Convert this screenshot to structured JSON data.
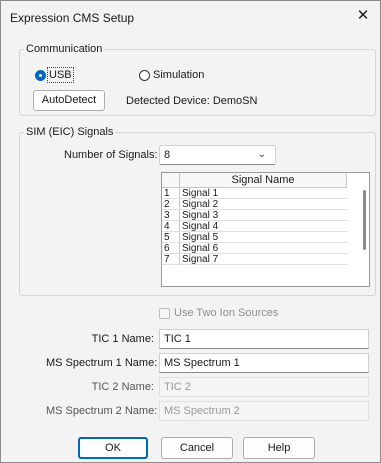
{
  "window": {
    "title": "Expression CMS Setup",
    "close_glyph": "✕"
  },
  "communication": {
    "group_label": "Communication",
    "usb_label": "USB",
    "simulation_label": "Simulation",
    "selected": "USB",
    "autodetect_label": "AutoDetect",
    "detected_text": "Detected Device: DemoSN"
  },
  "signals": {
    "group_label": "SIM (EIC) Signals",
    "count_label": "Number of Signals:",
    "count_value": "8",
    "table_header": "Signal Name",
    "rows": [
      {
        "num": "1",
        "name": "Signal 1"
      },
      {
        "num": "2",
        "name": "Signal 2"
      },
      {
        "num": "3",
        "name": "Signal 3"
      },
      {
        "num": "4",
        "name": "Signal 4"
      },
      {
        "num": "5",
        "name": "Signal 5"
      },
      {
        "num": "6",
        "name": "Signal 6"
      },
      {
        "num": "7",
        "name": "Signal 7"
      }
    ]
  },
  "ion_sources": {
    "label": "Use Two Ion Sources",
    "checked": false
  },
  "fields": {
    "tic1_label": "TIC 1 Name:",
    "tic1_value": "TIC 1",
    "ms1_label": "MS Spectrum 1 Name:",
    "ms1_value": "MS Spectrum 1",
    "tic2_label": "TIC 2 Name:",
    "tic2_value": "TIC 2",
    "ms2_label": "MS Spectrum 2 Name:",
    "ms2_value": "MS Spectrum 2"
  },
  "buttons": {
    "ok": "OK",
    "cancel": "Cancel",
    "help": "Help"
  },
  "colors": {
    "accent": "#0067c0",
    "window_bg": "#f3f3f3"
  }
}
